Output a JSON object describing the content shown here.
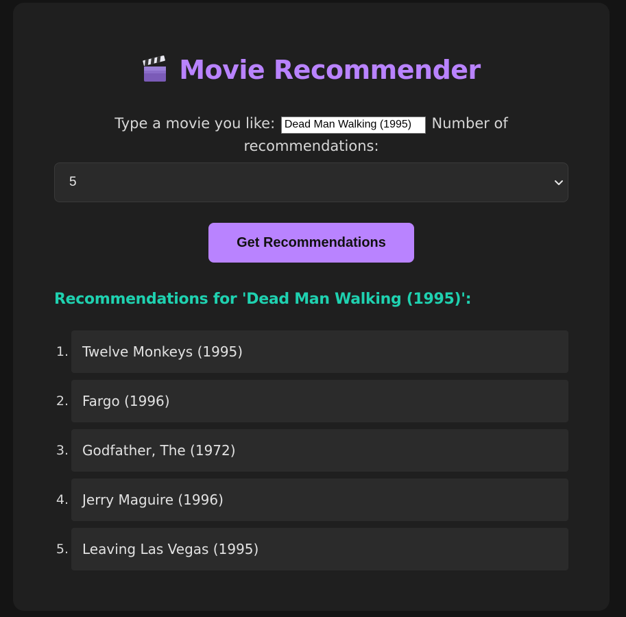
{
  "header": {
    "title": "Movie Recommender",
    "icon": "clapperboard-icon"
  },
  "form": {
    "movie_label": "Type a movie you like:",
    "movie_value": "Dead Man Walking (1995)",
    "count_label": "Number of recommendations:",
    "count_selected": "5",
    "submit_label": "Get Recommendations"
  },
  "results": {
    "heading": "Recommendations for 'Dead Man Walking (1995)':",
    "items": [
      {
        "num": "1.",
        "title": "Twelve Monkeys (1995)"
      },
      {
        "num": "2.",
        "title": "Fargo (1996)"
      },
      {
        "num": "3.",
        "title": "Godfather, The (1972)"
      },
      {
        "num": "4.",
        "title": "Jerry Maguire (1996)"
      },
      {
        "num": "5.",
        "title": "Leaving Las Vegas (1995)"
      }
    ]
  },
  "colors": {
    "accent": "#b983ff",
    "heading": "#1fd1b0",
    "card": "#1f1f1f",
    "background": "#141414"
  }
}
